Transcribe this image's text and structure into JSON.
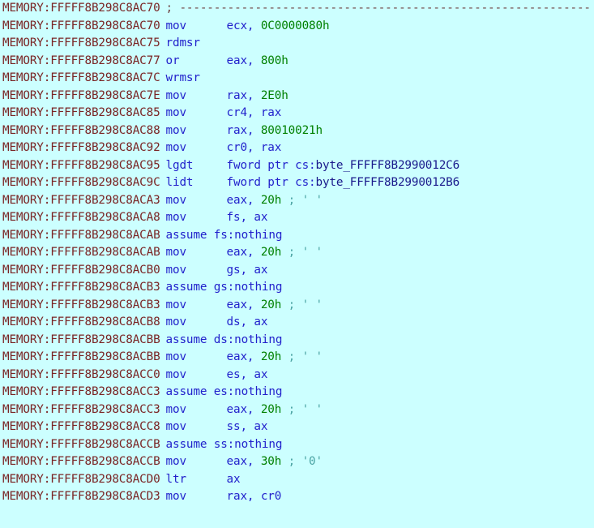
{
  "view": {
    "name": "IDA Pro disassembly listing",
    "segment": "MEMORY",
    "background_color": "#ccffff",
    "colors": {
      "address": "#7a2424",
      "mnemonic": "#2222cc",
      "operand_register": "#2222cc",
      "immediate": "#008000",
      "data_reference": "#1a1a8c",
      "comment": "#4aa3a3",
      "separator": "#6e4040"
    }
  },
  "lines": [
    {
      "address": "MEMORY:FFFFF8B298C8AC70",
      "kind": "separator",
      "separator": "; ------------------------------------------------------------"
    },
    {
      "address": "MEMORY:FFFFF8B298C8AC70",
      "kind": "instruction",
      "mnemonic": "mov",
      "operand_prefix": "ecx, ",
      "immediate": "0C0000080h",
      "operand_suffix": "",
      "comment": ""
    },
    {
      "address": "MEMORY:FFFFF8B298C8AC75",
      "kind": "instruction",
      "mnemonic": "rdmsr",
      "operand_prefix": "",
      "immediate": "",
      "operand_suffix": "",
      "comment": ""
    },
    {
      "address": "MEMORY:FFFFF8B298C8AC77",
      "kind": "instruction",
      "mnemonic": "or",
      "operand_prefix": "eax, ",
      "immediate": "800h",
      "operand_suffix": "",
      "comment": ""
    },
    {
      "address": "MEMORY:FFFFF8B298C8AC7C",
      "kind": "instruction",
      "mnemonic": "wrmsr",
      "operand_prefix": "",
      "immediate": "",
      "operand_suffix": "",
      "comment": ""
    },
    {
      "address": "MEMORY:FFFFF8B298C8AC7E",
      "kind": "instruction",
      "mnemonic": "mov",
      "operand_prefix": "rax, ",
      "immediate": "2E0h",
      "operand_suffix": "",
      "comment": ""
    },
    {
      "address": "MEMORY:FFFFF8B298C8AC85",
      "kind": "instruction",
      "mnemonic": "mov",
      "operand_prefix": "cr4, rax",
      "immediate": "",
      "operand_suffix": "",
      "comment": ""
    },
    {
      "address": "MEMORY:FFFFF8B298C8AC88",
      "kind": "instruction",
      "mnemonic": "mov",
      "operand_prefix": "rax, ",
      "immediate": "80010021h",
      "operand_suffix": "",
      "comment": ""
    },
    {
      "address": "MEMORY:FFFFF8B298C8AC92",
      "kind": "instruction",
      "mnemonic": "mov",
      "operand_prefix": "cr0, rax",
      "immediate": "",
      "operand_suffix": "",
      "comment": ""
    },
    {
      "address": "MEMORY:FFFFF8B298C8AC95",
      "kind": "instruction_dataref",
      "mnemonic": "lgdt",
      "operand_prefix": "fword ptr cs:",
      "dataref": "byte_FFFFF8B2990012C6",
      "comment": ""
    },
    {
      "address": "MEMORY:FFFFF8B298C8AC9C",
      "kind": "instruction_dataref",
      "mnemonic": "lidt",
      "operand_prefix": "fword ptr cs:",
      "dataref": "byte_FFFFF8B2990012B6",
      "comment": ""
    },
    {
      "address": "MEMORY:FFFFF8B298C8ACA3",
      "kind": "instruction",
      "mnemonic": "mov",
      "operand_prefix": "eax, ",
      "immediate": "20h",
      "operand_suffix": "",
      "comment": "; ' '"
    },
    {
      "address": "MEMORY:FFFFF8B298C8ACA8",
      "kind": "instruction",
      "mnemonic": "mov",
      "operand_prefix": "fs, ax",
      "immediate": "",
      "operand_suffix": "",
      "comment": ""
    },
    {
      "address": "MEMORY:FFFFF8B298C8ACAB",
      "kind": "assume",
      "text": "assume fs:nothing"
    },
    {
      "address": "MEMORY:FFFFF8B298C8ACAB",
      "kind": "instruction",
      "mnemonic": "mov",
      "operand_prefix": "eax, ",
      "immediate": "20h",
      "operand_suffix": "",
      "comment": "; ' '"
    },
    {
      "address": "MEMORY:FFFFF8B298C8ACB0",
      "kind": "instruction",
      "mnemonic": "mov",
      "operand_prefix": "gs, ax",
      "immediate": "",
      "operand_suffix": "",
      "comment": ""
    },
    {
      "address": "MEMORY:FFFFF8B298C8ACB3",
      "kind": "assume",
      "text": "assume gs:nothing"
    },
    {
      "address": "MEMORY:FFFFF8B298C8ACB3",
      "kind": "instruction",
      "mnemonic": "mov",
      "operand_prefix": "eax, ",
      "immediate": "20h",
      "operand_suffix": "",
      "comment": "; ' '"
    },
    {
      "address": "MEMORY:FFFFF8B298C8ACB8",
      "kind": "instruction",
      "mnemonic": "mov",
      "operand_prefix": "ds, ax",
      "immediate": "",
      "operand_suffix": "",
      "comment": ""
    },
    {
      "address": "MEMORY:FFFFF8B298C8ACBB",
      "kind": "assume",
      "text": "assume ds:nothing"
    },
    {
      "address": "MEMORY:FFFFF8B298C8ACBB",
      "kind": "instruction",
      "mnemonic": "mov",
      "operand_prefix": "eax, ",
      "immediate": "20h",
      "operand_suffix": "",
      "comment": "; ' '"
    },
    {
      "address": "MEMORY:FFFFF8B298C8ACC0",
      "kind": "instruction",
      "mnemonic": "mov",
      "operand_prefix": "es, ax",
      "immediate": "",
      "operand_suffix": "",
      "comment": ""
    },
    {
      "address": "MEMORY:FFFFF8B298C8ACC3",
      "kind": "assume",
      "text": "assume es:nothing"
    },
    {
      "address": "MEMORY:FFFFF8B298C8ACC3",
      "kind": "instruction",
      "mnemonic": "mov",
      "operand_prefix": "eax, ",
      "immediate": "20h",
      "operand_suffix": "",
      "comment": "; ' '"
    },
    {
      "address": "MEMORY:FFFFF8B298C8ACC8",
      "kind": "instruction",
      "mnemonic": "mov",
      "operand_prefix": "ss, ax",
      "immediate": "",
      "operand_suffix": "",
      "comment": ""
    },
    {
      "address": "MEMORY:FFFFF8B298C8ACCB",
      "kind": "assume",
      "text": "assume ss:nothing"
    },
    {
      "address": "MEMORY:FFFFF8B298C8ACCB",
      "kind": "instruction",
      "mnemonic": "mov",
      "operand_prefix": "eax, ",
      "immediate": "30h",
      "operand_suffix": "",
      "comment": "; '0'"
    },
    {
      "address": "MEMORY:FFFFF8B298C8ACD0",
      "kind": "instruction",
      "mnemonic": "ltr",
      "operand_prefix": "ax",
      "immediate": "",
      "operand_suffix": "",
      "comment": ""
    },
    {
      "address": "MEMORY:FFFFF8B298C8ACD3",
      "kind": "instruction",
      "mnemonic": "mov",
      "operand_prefix": "rax, cr0",
      "immediate": "",
      "operand_suffix": "",
      "comment": ""
    }
  ]
}
